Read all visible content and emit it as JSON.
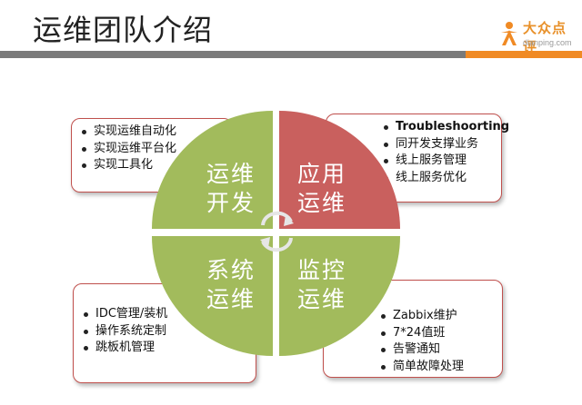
{
  "header": {
    "title": "运维团队介绍",
    "logo": {
      "name": "大众点评",
      "url": "dianping.com"
    }
  },
  "colors": {
    "green": "#a2bb5c",
    "red": "#c9605e",
    "accent_orange": "#f08a24",
    "bar_gray": "#7a7a7a",
    "box_border": "#c0504d"
  },
  "quadrants": {
    "top_left": {
      "line1": "运维",
      "line2": "开发",
      "color": "green"
    },
    "top_right": {
      "line1": "应用",
      "line2": "运维",
      "color": "red"
    },
    "bottom_left": {
      "line1": "系统",
      "line2": "运维",
      "color": "green"
    },
    "bottom_right": {
      "line1": "监控",
      "line2": "运维",
      "color": "green"
    }
  },
  "center_icon": "cycle-arrows-icon",
  "boxes": {
    "top_left": [
      "实现运维自动化",
      "实现运维平台化",
      "实现工具化"
    ],
    "top_right": [
      "Troubleshoorting",
      "同开发支撑业务",
      "线上服务管理",
      "线上服务优化"
    ],
    "bottom_left": [
      "IDC管理/装机",
      "操作系统定制",
      "跳板机管理"
    ],
    "bottom_right": [
      "Zabbix维护",
      "7*24值班",
      "告警通知",
      "简单故障处理"
    ]
  }
}
